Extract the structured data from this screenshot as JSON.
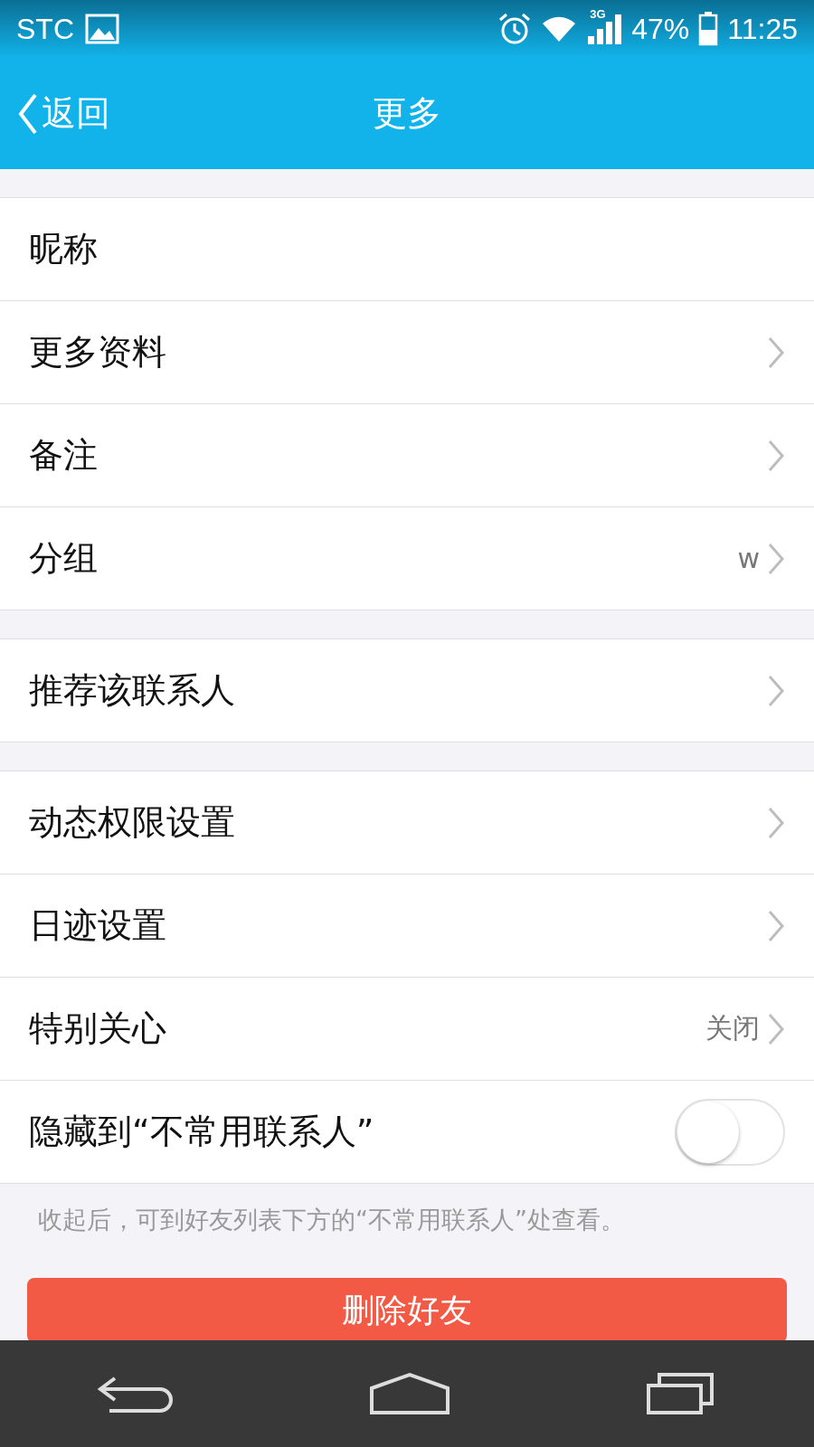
{
  "status_bar": {
    "carrier": "STC",
    "network": "3G",
    "battery": "47%",
    "time": "11:25"
  },
  "header": {
    "back": "返回",
    "title": "更多"
  },
  "groups": [
    {
      "rows": [
        {
          "kind": "plain",
          "label": "昵称"
        },
        {
          "kind": "link",
          "label": "更多资料"
        },
        {
          "kind": "link",
          "label": "备注"
        },
        {
          "kind": "link",
          "label": "分组",
          "value": "w"
        }
      ]
    },
    {
      "rows": [
        {
          "kind": "link",
          "label": "推荐该联系人"
        }
      ]
    },
    {
      "rows": [
        {
          "kind": "link",
          "label": "动态权限设置"
        },
        {
          "kind": "link",
          "label": "日迹设置"
        },
        {
          "kind": "link",
          "label": "特别关心",
          "value": "关闭"
        },
        {
          "kind": "toggle",
          "label": "隐藏到“不常用联系人”",
          "on": false
        }
      ]
    }
  ],
  "hint": "收起后，可到好友列表下方的“不常用联系人”处查看。",
  "delete_button": "删除好友"
}
